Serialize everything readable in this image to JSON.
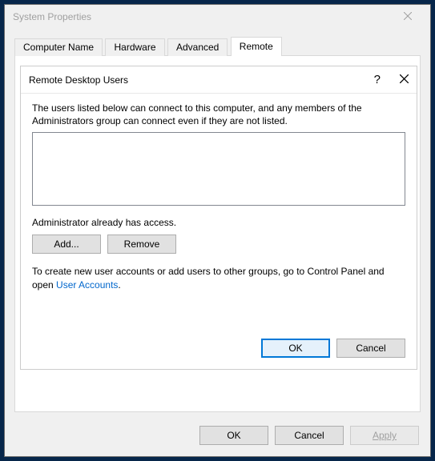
{
  "window": {
    "title": "System Properties"
  },
  "tabs": {
    "t0": "Computer Name",
    "t1": "Hardware",
    "t2": "Advanced",
    "t3": "Remote"
  },
  "dialog": {
    "title": "Remote Desktop Users",
    "help_symbol": "?",
    "desc": "The users listed below can connect to this computer, and any members of the Administrators group can connect even if they are not listed.",
    "admin_note": "Administrator already has access.",
    "add_label": "Add...",
    "remove_label": "Remove",
    "hint_pre": "To create new user accounts or add users to other groups, go to Control Panel and open ",
    "hint_link": "User Accounts",
    "hint_post": ".",
    "ok_label": "OK",
    "cancel_label": "Cancel"
  },
  "outer_buttons": {
    "ok": "OK",
    "cancel": "Cancel",
    "apply": "Apply"
  }
}
